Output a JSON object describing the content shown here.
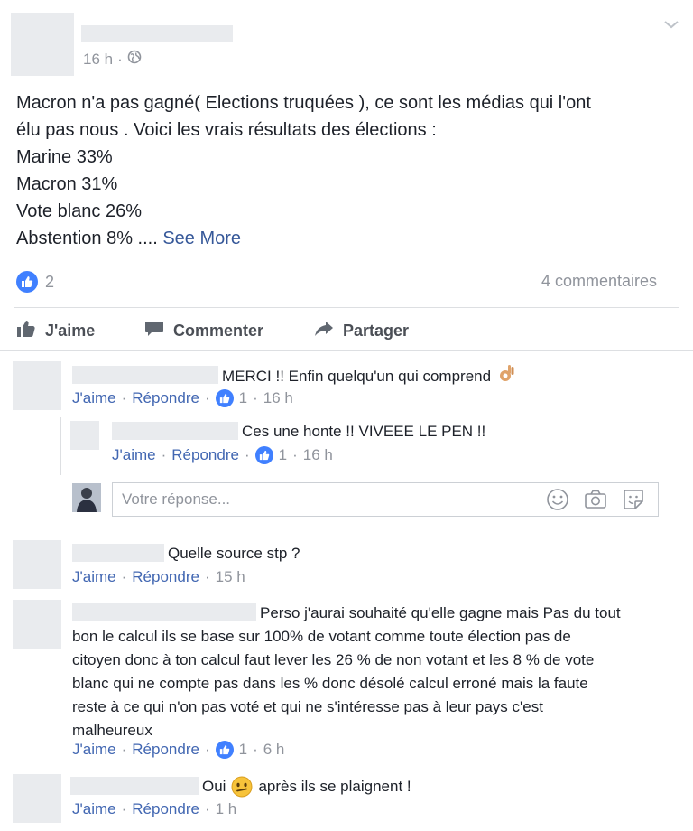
{
  "post": {
    "meta_time": "16 h",
    "meta_dot": "·",
    "text_lines": [
      "Macron n'a pas gagné( Elections truquées ), ce sont les médias qui l'ont",
      "élu pas nous . Voici les vrais résultats des élections :",
      "Marine 33%",
      "Macron 31%",
      "Vote blanc 26%"
    ],
    "last_line_text": "Abstention 8% .... ",
    "see_more": "See More",
    "like_count": "2",
    "comments_count": "4 commentaires"
  },
  "actions": {
    "like": "J'aime",
    "comment": "Commenter",
    "share": "Partager"
  },
  "comment_actions": {
    "like": "J'aime",
    "reply": "Répondre",
    "sep": "·"
  },
  "comments": [
    {
      "text": "MERCI !! Enfin quelqu'un qui comprend",
      "likes": "1",
      "time": "16 h"
    },
    {
      "text": "Ces une honte !! VIVEEE LE PEN !!",
      "likes": "1",
      "time": "16 h"
    },
    {
      "text": "Quelle source stp ?",
      "time": "15 h"
    },
    {
      "text_lines": [
        "Perso j'aurai souhaité qu'elle gagne mais Pas du tout",
        "bon le calcul ils se base sur 100% de votant comme toute élection pas de",
        "citoyen donc à ton calcul faut lever les 26 % de non votant et les 8 % de vote",
        "blanc qui ne compte pas dans les % donc désolé calcul erroné mais la faute",
        "reste à ce qui n'on pas voté et qui ne s'intéresse pas à leur pays c'est",
        "malheureux"
      ],
      "likes": "1",
      "time": "6 h"
    },
    {
      "text_before": "Oui",
      "text_after": "après ils se plaignent !",
      "time": "1 h"
    }
  ],
  "reply_box": {
    "placeholder": "Votre réponse..."
  },
  "colors": {
    "link": "#365899",
    "like_blue": "#4080ff",
    "meta_gray": "#90949c",
    "redact_gray": "#e9ebee"
  }
}
